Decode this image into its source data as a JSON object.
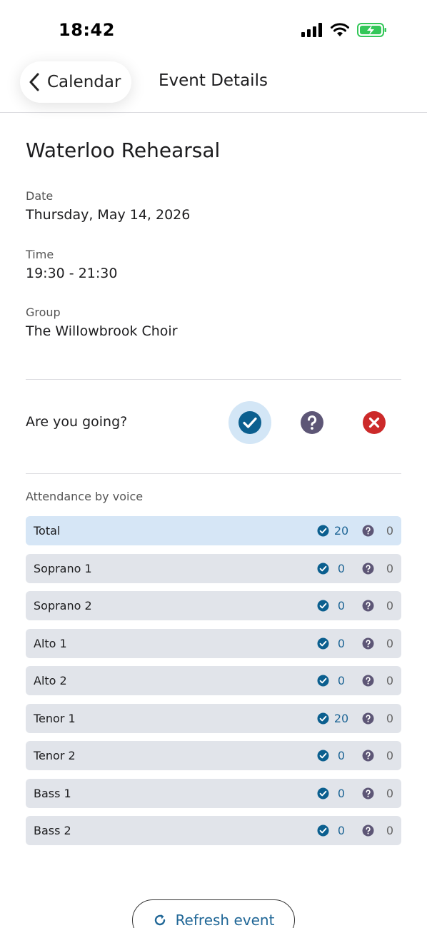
{
  "status_bar": {
    "time": "18:42"
  },
  "header": {
    "back_label": "Calendar",
    "title": "Event Details"
  },
  "event": {
    "title": "Waterloo Rehearsal",
    "date_label": "Date",
    "date_value": "Thursday, May 14, 2026",
    "time_label": "Time",
    "time_value": "19:30 - 21:30",
    "group_label": "Group",
    "group_value": "The Willowbrook Choir"
  },
  "rsvp": {
    "question": "Are you going?",
    "selected": "yes"
  },
  "attendance": {
    "label": "Attendance by voice",
    "rows": [
      {
        "name": "Total",
        "yes": "20",
        "maybe": "0"
      },
      {
        "name": "Soprano 1",
        "yes": "0",
        "maybe": "0"
      },
      {
        "name": "Soprano 2",
        "yes": "0",
        "maybe": "0"
      },
      {
        "name": "Alto 1",
        "yes": "0",
        "maybe": "0"
      },
      {
        "name": "Alto 2",
        "yes": "0",
        "maybe": "0"
      },
      {
        "name": "Tenor 1",
        "yes": "20",
        "maybe": "0"
      },
      {
        "name": "Tenor 2",
        "yes": "0",
        "maybe": "0"
      },
      {
        "name": "Bass 1",
        "yes": "0",
        "maybe": "0"
      },
      {
        "name": "Bass 2",
        "yes": "0",
        "maybe": "0"
      }
    ]
  },
  "refresh": {
    "label": "Refresh event"
  },
  "colors": {
    "accent": "#1f6696",
    "yes": "#0b5f8f",
    "maybe": "#5d5676",
    "no": "#cc2a2a",
    "battery": "#34c759"
  }
}
